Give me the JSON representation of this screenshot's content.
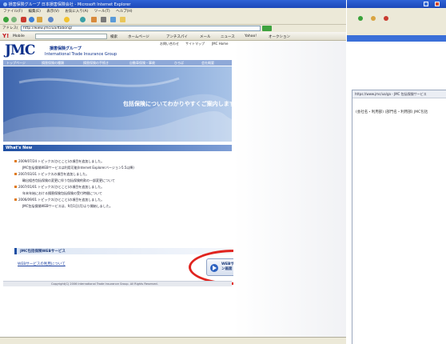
{
  "window": {
    "title": "損害保険グループ 日本損害保険会社 - Microsoft Internet Explorer",
    "menu": [
      "ファイル(F)",
      "編集(E)",
      "表示(V)",
      "お気に入り(A)",
      "ツール(T)",
      "ヘルプ(H)"
    ],
    "address_label": "アドレス(D)",
    "address": "http://www.jmc/ua/Itabong/",
    "yahoo_items": [
      "Y!",
      "Mobile",
      "検索",
      "ホームページ",
      "アンチスパイ",
      "メール",
      "ニュース",
      "Yahoo!",
      "オークション"
    ]
  },
  "site": {
    "logo": "JMC",
    "group_name": "損害保険グループ",
    "group_name_en": "International Trade Insurance Group",
    "utility_links": [
      "お問い合わせ",
      "サイトマップ",
      "JMC Home"
    ],
    "nav_tabs": [
      "トップページ",
      "損害保険の種類",
      "損害保険の手続き",
      "自動車保険・事故",
      "ひろば",
      "会社概要"
    ],
    "banner_text": "包括保険についてわかりやすくご案内します。",
    "whats_new_heading": "What's New",
    "news": [
      "2009/07/24 トピックス(ひとこと)の項目を追加しました。",
      "JMC包括保険WEBサービスは利用可能(Internet Explorerバージョン5.5以降)",
      "2007/03/31 トピックスの項目を追加しました。",
      "輸出組合包括保険の変更に伴う包括保険約款の一部変更について",
      "2007/01/01 トピックス(ひとこと)の項目を追加しました。",
      "年末年始における損害保険包括保険の受付時間について",
      "2006/09/01 トピックス(ひとこと)の項目を追加しました。",
      "JMC包括保険WEBサービスは、9月1日(月)より開始しました。"
    ],
    "web_section_title": "JMC包括保険WEBサービス",
    "web_service_link": "WEBサービスの利用について",
    "login_button": "WEBサービス ログイン画面",
    "footer": "Copyright(C) 2006 International Trade Insurance Group. All Rights Reserved."
  },
  "second_window": {
    "tab_title": "https://www.jmc/ua/ga - JMC 包括保険サービス",
    "form_line": "(会社名・利用部) (部門名・利用部) JMC包括"
  },
  "colors": {
    "titlebar": "#1c48b8",
    "nav": "#8fa9d8",
    "banner": "#6a8ec7",
    "highlight": "#e0241f"
  }
}
